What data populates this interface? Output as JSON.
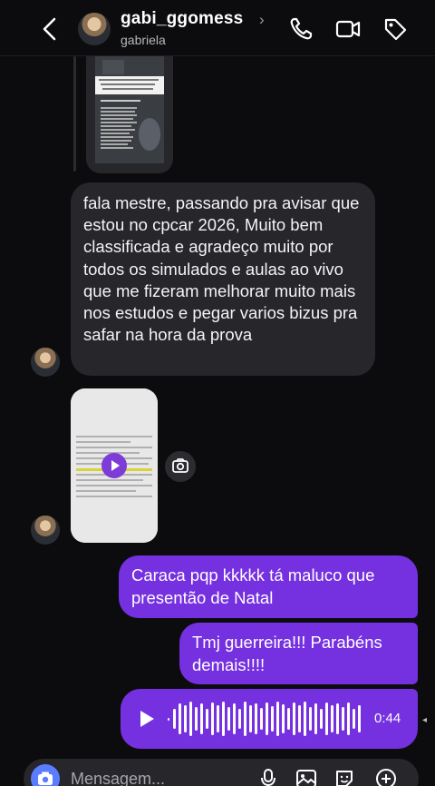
{
  "header": {
    "username": "gabi_ggomess",
    "subtitle": "gabriela",
    "chevron": "›",
    "icons": [
      "back-icon",
      "phone-icon",
      "video-call-icon",
      "tag-icon"
    ]
  },
  "shared_post": {
    "caption": "Hello! presente de Natal cm espírito carnaval 🎅🎄 A uma breve sequência sobre sucesso"
  },
  "messages": {
    "incoming_text": "fala mestre, passando pra avisar que estou no cpcar 2026, Muito bem classificada e agradeço muito por todos os simulados e aulas ao vivo que me fizeram melhorar muito mais nos estudos e pegar varios bizus pra safar na hora da prova",
    "outgoing_1": "Caraca pqp kkkkk tá maluco que presentão de Natal",
    "outgoing_2": "Tmj guerreira!!! Parabéns demais!!!!",
    "voice_duration": "0:44"
  },
  "composer": {
    "placeholder": "Mensagem..."
  },
  "colors": {
    "background": "#0c0c0e",
    "incoming_bubble": "#26262b",
    "outgoing_bubble": "#7530e0",
    "accent_blue": "#5a7cff"
  }
}
